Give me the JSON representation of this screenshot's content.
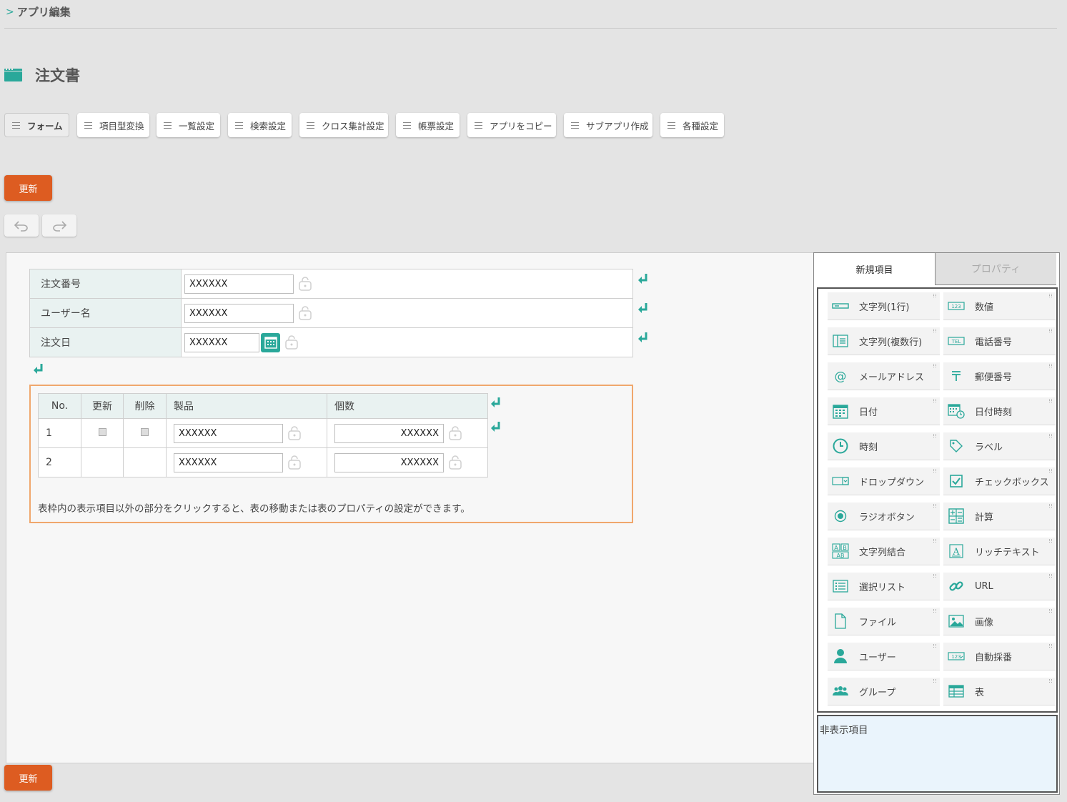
{
  "breadcrumb": {
    "label": "アプリ編集"
  },
  "app": {
    "title": "注文書"
  },
  "tabs": [
    "フォーム",
    "項目型変換",
    "一覧設定",
    "検索設定",
    "クロス集計設定",
    "帳票設定",
    "アプリをコピー",
    "サブアプリ作成",
    "各種設定"
  ],
  "actions": {
    "update_top": "更新",
    "update_bottom": "更新"
  },
  "form": {
    "fields": [
      {
        "label": "注文番号",
        "value": "XXXXXX"
      },
      {
        "label": "ユーザー名",
        "value": "XXXXXX"
      },
      {
        "label": "注文日",
        "value": "XXXXXX"
      }
    ]
  },
  "subtable": {
    "headers": [
      "No.",
      "更新",
      "削除",
      "製品",
      "個数"
    ],
    "rows": [
      {
        "no": "1",
        "product": "XXXXXX",
        "qty": "XXXXXX"
      },
      {
        "no": "2",
        "product": "XXXXXX",
        "qty": "XXXXXX"
      }
    ],
    "note": "表枠内の表示項目以外の部分をクリックすると、表の移動または表のプロパティの設定ができます。"
  },
  "panel": {
    "tab_new": "新規項目",
    "tab_props": "プロパティ",
    "items": [
      {
        "label": "文字列(1行)",
        "icon": "single-line-text-icon"
      },
      {
        "label": "数値",
        "icon": "number-icon"
      },
      {
        "label": "文字列(複数行)",
        "icon": "multi-line-text-icon"
      },
      {
        "label": "電話番号",
        "icon": "phone-tel-icon"
      },
      {
        "label": "メールアドレス",
        "icon": "at-mail-icon"
      },
      {
        "label": "郵便番号",
        "icon": "postal-mark-icon"
      },
      {
        "label": "日付",
        "icon": "calendar-icon"
      },
      {
        "label": "日付時刻",
        "icon": "calendar-clock-icon"
      },
      {
        "label": "時刻",
        "icon": "clock-icon"
      },
      {
        "label": "ラベル",
        "icon": "tag-icon"
      },
      {
        "label": "ドロップダウン",
        "icon": "dropdown-icon"
      },
      {
        "label": "チェックボックス",
        "icon": "checkbox-icon"
      },
      {
        "label": "ラジオボタン",
        "icon": "radio-button-icon"
      },
      {
        "label": "計算",
        "icon": "calculator-icon"
      },
      {
        "label": "文字列結合",
        "icon": "text-join-icon"
      },
      {
        "label": "リッチテキスト",
        "icon": "rich-text-icon"
      },
      {
        "label": "選択リスト",
        "icon": "select-list-icon"
      },
      {
        "label": "URL",
        "icon": "link-icon"
      },
      {
        "label": "ファイル",
        "icon": "file-icon"
      },
      {
        "label": "画像",
        "icon": "image-icon"
      },
      {
        "label": "ユーザー",
        "icon": "user-icon"
      },
      {
        "label": "自動採番",
        "icon": "auto-number-icon"
      },
      {
        "label": "グループ",
        "icon": "group-icon"
      },
      {
        "label": "表",
        "icon": "table-icon"
      }
    ],
    "hidden_label": "非表示項目"
  },
  "colors": {
    "accent": "#2aa89a",
    "update": "#dd5c21",
    "subtable_border": "#f0a76c"
  }
}
